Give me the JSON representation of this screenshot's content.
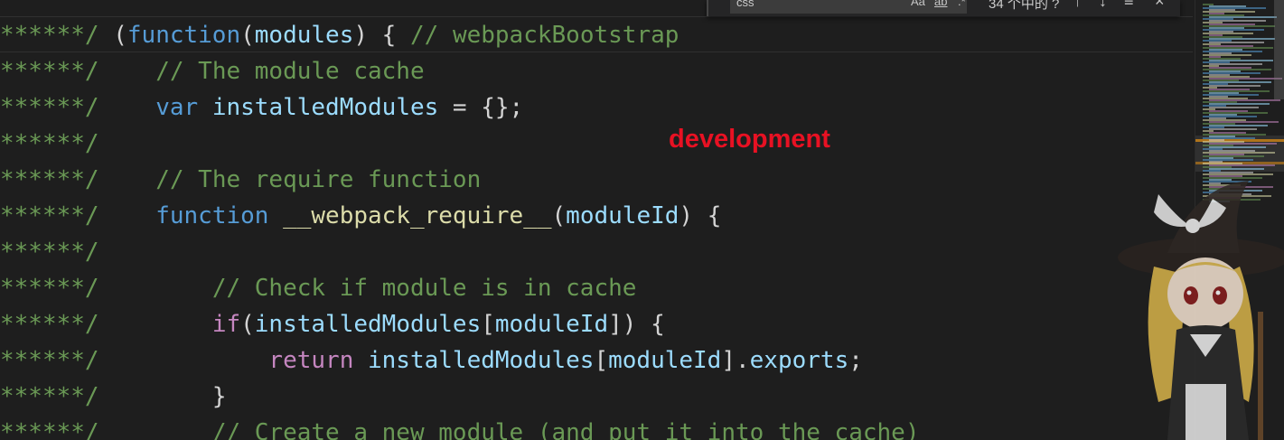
{
  "annotation": "development",
  "find_widget": {
    "query": "css",
    "case_icon": "Aa",
    "word_icon": "ab",
    "regex_icon": ".*",
    "result_count": "34 个中的 ?",
    "prev_icon": "arrow-up-icon",
    "next_icon": "arrow-down-icon",
    "selection_icon": "find-in-selection-icon",
    "close_icon": "close-icon"
  },
  "code_lines": [
    [
      {
        "t": "******/ ",
        "c": "cm"
      },
      {
        "t": "(",
        "c": "p"
      },
      {
        "t": "function",
        "c": "kw"
      },
      {
        "t": "(",
        "c": "p"
      },
      {
        "t": "modules",
        "c": "var"
      },
      {
        "t": ") { ",
        "c": "p"
      },
      {
        "t": "// webpackBootstrap",
        "c": "cm"
      }
    ],
    [
      {
        "t": "******/ ",
        "c": "cm"
      },
      {
        "t": "   ",
        "c": "p"
      },
      {
        "t": "// The module cache",
        "c": "cm"
      }
    ],
    [
      {
        "t": "******/ ",
        "c": "cm"
      },
      {
        "t": "   ",
        "c": "p"
      },
      {
        "t": "var",
        "c": "kw"
      },
      {
        "t": " ",
        "c": "p"
      },
      {
        "t": "installedModules",
        "c": "var"
      },
      {
        "t": " = {};",
        "c": "p"
      }
    ],
    [
      {
        "t": "******/",
        "c": "cm"
      }
    ],
    [
      {
        "t": "******/ ",
        "c": "cm"
      },
      {
        "t": "   ",
        "c": "p"
      },
      {
        "t": "// The require function",
        "c": "cm"
      }
    ],
    [
      {
        "t": "******/ ",
        "c": "cm"
      },
      {
        "t": "   ",
        "c": "p"
      },
      {
        "t": "function",
        "c": "kw"
      },
      {
        "t": " ",
        "c": "p"
      },
      {
        "t": "__webpack_require__",
        "c": "fn"
      },
      {
        "t": "(",
        "c": "p"
      },
      {
        "t": "moduleId",
        "c": "var"
      },
      {
        "t": ") {",
        "c": "p"
      }
    ],
    [
      {
        "t": "******/",
        "c": "cm"
      }
    ],
    [
      {
        "t": "******/ ",
        "c": "cm"
      },
      {
        "t": "       ",
        "c": "p"
      },
      {
        "t": "// Check if module is in cache",
        "c": "cm"
      }
    ],
    [
      {
        "t": "******/ ",
        "c": "cm"
      },
      {
        "t": "       ",
        "c": "p"
      },
      {
        "t": "if",
        "c": "ctrl"
      },
      {
        "t": "(",
        "c": "p"
      },
      {
        "t": "installedModules",
        "c": "var"
      },
      {
        "t": "[",
        "c": "p"
      },
      {
        "t": "moduleId",
        "c": "var"
      },
      {
        "t": "]) {",
        "c": "p"
      }
    ],
    [
      {
        "t": "******/ ",
        "c": "cm"
      },
      {
        "t": "           ",
        "c": "p"
      },
      {
        "t": "return",
        "c": "ctrl"
      },
      {
        "t": " ",
        "c": "p"
      },
      {
        "t": "installedModules",
        "c": "var"
      },
      {
        "t": "[",
        "c": "p"
      },
      {
        "t": "moduleId",
        "c": "var"
      },
      {
        "t": "].",
        "c": "p"
      },
      {
        "t": "exports",
        "c": "var"
      },
      {
        "t": ";",
        "c": "p"
      }
    ],
    [
      {
        "t": "******/ ",
        "c": "cm"
      },
      {
        "t": "       ",
        "c": "p"
      },
      {
        "t": "}",
        "c": "p"
      }
    ],
    [
      {
        "t": "******/ ",
        "c": "cm"
      },
      {
        "t": "       ",
        "c": "p"
      },
      {
        "t": "// Create a new module (and put it into the cache)",
        "c": "cm"
      }
    ]
  ],
  "colors": {
    "background": "#1e1e1e",
    "comment": "#6a9955",
    "keyword": "#569cd6",
    "control": "#c586c0",
    "variable": "#9cdcfe",
    "function": "#dcdcaa",
    "annotation": "#e81123"
  }
}
